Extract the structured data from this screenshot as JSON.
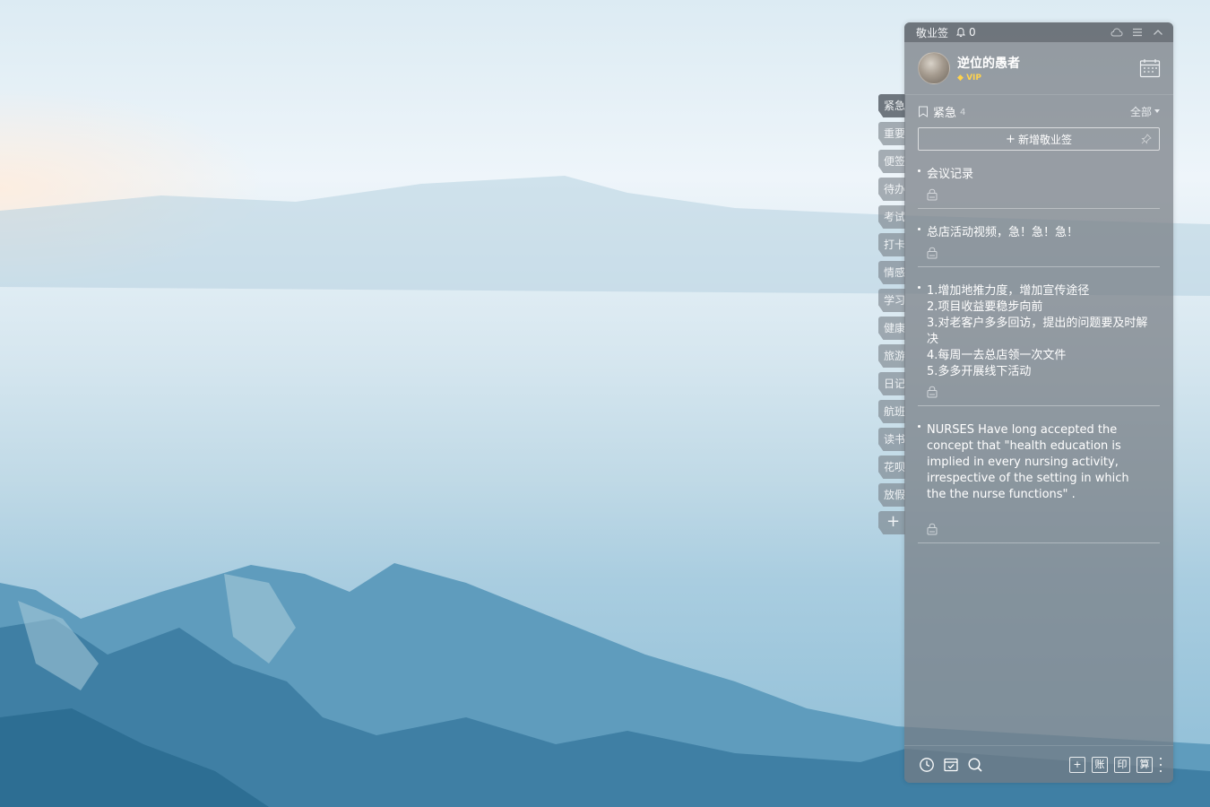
{
  "app": {
    "title": "敬业签",
    "reminder_count": "0"
  },
  "user": {
    "name": "逆位的愚者",
    "badge": "VIP"
  },
  "side_tabs": [
    "紧急",
    "重要",
    "便签",
    "待办",
    "考试",
    "打卡",
    "情感",
    "学习",
    "健康",
    "旅游",
    "日记",
    "航班",
    "读书",
    "花呗",
    "放假"
  ],
  "side_tab_add": "+",
  "category": {
    "name": "紧急",
    "count": "4",
    "filter_label": "全部"
  },
  "new_button": {
    "plus": "+",
    "label": "新增敬业签"
  },
  "notes": [
    {
      "lines": [
        "会议记录"
      ]
    },
    {
      "lines": [
        "总店活动视频，急！急！急！"
      ]
    },
    {
      "lines": [
        "1.增加地推力度，增加宣传途径",
        "2.项目收益要稳步向前",
        "3.对老客户多多回访，提出的问题要及时解",
        "决",
        "4.每周一去总店领一次文件",
        "5.多多开展线下活动"
      ]
    },
    {
      "text": "NURSES Have long accepted the concept that \"health education is implied in every nursing activity, irrespective of the setting in which the the nurse functions\" ."
    }
  ],
  "bottom_tools": {
    "add": "+",
    "account": "账",
    "stamp": "印",
    "calc": "算"
  },
  "icons": {
    "bell": "bell-icon",
    "cloud": "cloud-icon",
    "menu": "menu-icon",
    "collapse": "chevron-up-icon",
    "calendar": "calendar-icon",
    "flag": "bookmark-icon",
    "pin": "pin-icon",
    "lock": "lock-icon",
    "clock": "clock-icon",
    "check": "checklist-icon",
    "search": "search-icon",
    "more": "more-icon"
  }
}
